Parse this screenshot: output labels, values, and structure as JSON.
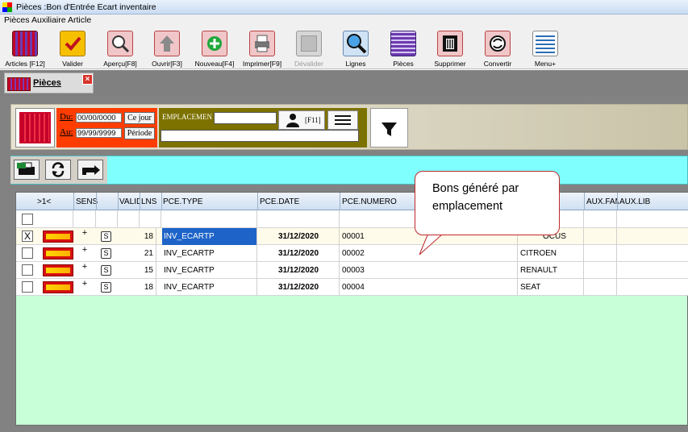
{
  "window": {
    "title": "Pièces :Bon d'Entrée Ecart inventaire"
  },
  "menu": {
    "items": [
      "Pièces",
      "Auxiliaire",
      "Article"
    ]
  },
  "toolbar": {
    "buttons": [
      {
        "label": "Articles [F12]",
        "icon": "articles-icon"
      },
      {
        "label": "Valider",
        "icon": "checkmark-icon"
      },
      {
        "label": "Aperçu[F8]",
        "icon": "preview-icon"
      },
      {
        "label": "Ouvrir[F3]",
        "icon": "open-arrow-icon"
      },
      {
        "label": "Nouveau[F4]",
        "icon": "new-plus-icon"
      },
      {
        "label": "Imprimer[F9]",
        "icon": "printer-icon"
      },
      {
        "label": "Dévalider",
        "icon": "unvalidate-icon"
      },
      {
        "label": "Lignes",
        "icon": "magnifier-icon"
      },
      {
        "label": "Pièces",
        "icon": "pieces-icon"
      },
      {
        "label": "Supprimer",
        "icon": "trash-icon"
      },
      {
        "label": "Convertir",
        "icon": "convert-icon"
      },
      {
        "label": "Menu+",
        "icon": "menu-lines-icon"
      }
    ]
  },
  "tab": {
    "label": "Pièces",
    "close": "×"
  },
  "filters": {
    "du_label": "Du:",
    "au_label": "Au:",
    "du_value": "00/00/0000",
    "au_value": "99/99/9999",
    "ce_jour": "Ce jour",
    "periode": "Période",
    "emplacement_label": "EMPLACEMEN",
    "f11": "[F11]"
  },
  "grid": {
    "columns": [
      "&gt;1&lt;",
      "SENS",
      "VALID",
      "LNS",
      "PCE.TYPE",
      "PCE.DATE",
      "PCE.NUMERO",
      "AUX.FAM",
      "AUX.LIB"
    ],
    "col_first": ">1<",
    "rows": [
      {
        "checked": "X",
        "sens": "+",
        "lns": "18",
        "type": "INV_ECARTP",
        "date": "31/12/2020",
        "numero": "00001",
        "aux": "OCUS"
      },
      {
        "checked": "",
        "sens": "+",
        "lns": "21",
        "type": "INV_ECARTP",
        "date": "31/12/2020",
        "numero": "00002",
        "aux": "CITROEN"
      },
      {
        "checked": "",
        "sens": "+",
        "lns": "15",
        "type": "INV_ECARTP",
        "date": "31/12/2020",
        "numero": "00003",
        "aux": "RENAULT"
      },
      {
        "checked": "",
        "sens": "+",
        "lns": "18",
        "type": "INV_ECARTP",
        "date": "31/12/2020",
        "numero": "00004",
        "aux": "SEAT"
      }
    ]
  },
  "callout": {
    "text": "Bons généré par emplacement"
  }
}
